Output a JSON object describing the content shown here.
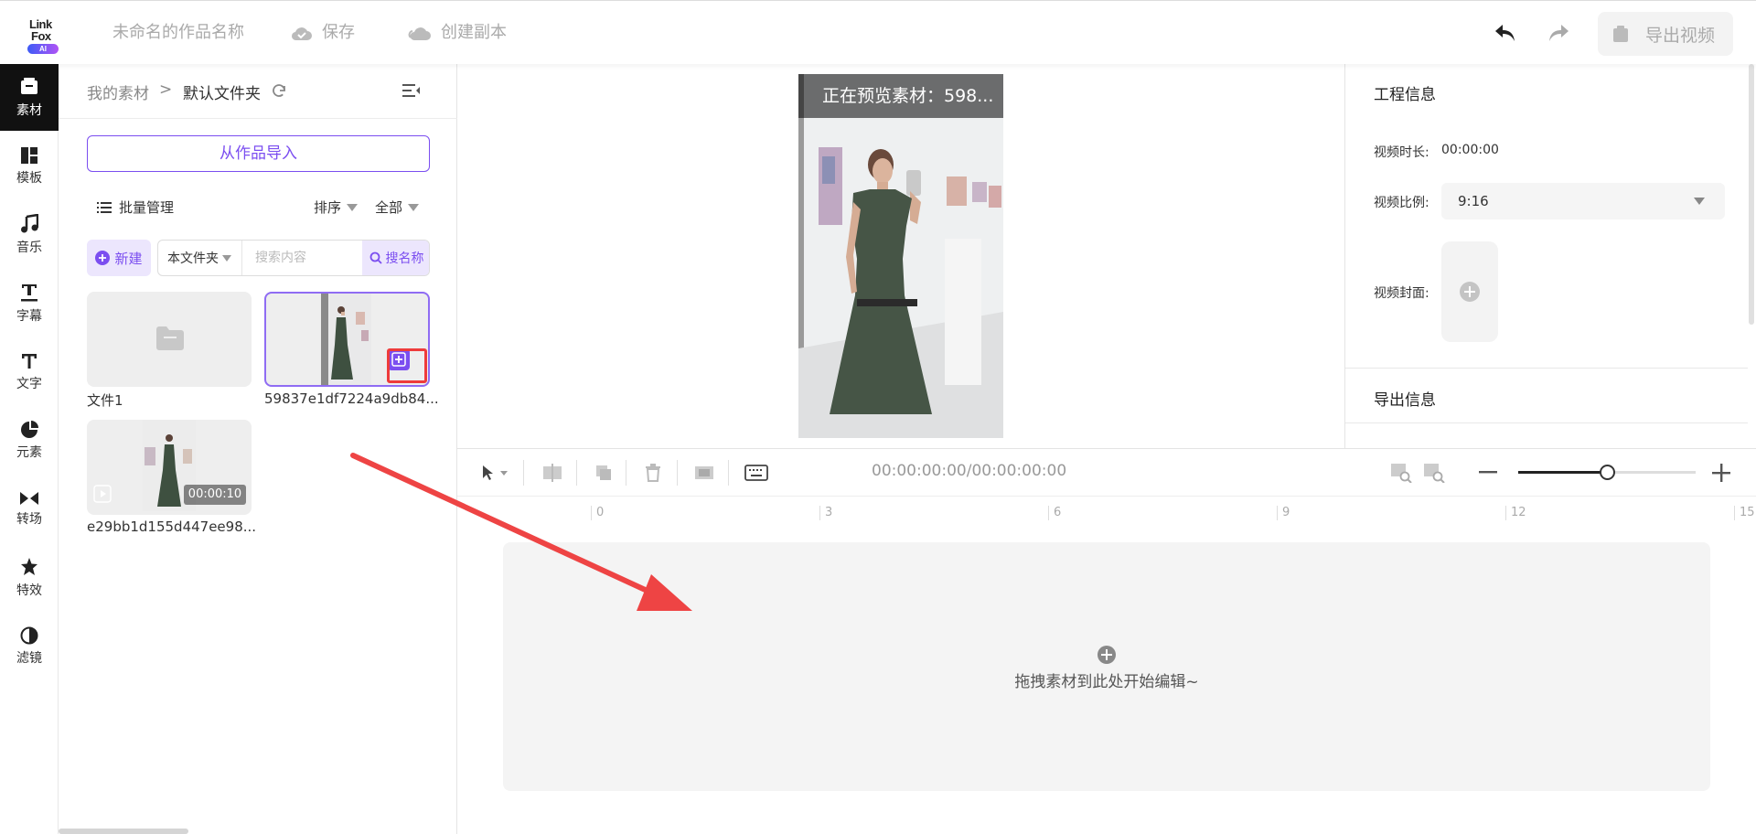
{
  "topbar": {
    "logo_line1": "Link",
    "logo_line2": "Fox",
    "logo_badge": "AI",
    "project_name": "未命名的作品名称",
    "save_label": "保存",
    "copy_label": "创建副本",
    "export_label": "导出视频"
  },
  "sidebar": {
    "items": [
      {
        "label": "素材",
        "icon": "material-icon"
      },
      {
        "label": "模板",
        "icon": "template-icon"
      },
      {
        "label": "音乐",
        "icon": "music-icon"
      },
      {
        "label": "字幕",
        "icon": "subtitle-icon"
      },
      {
        "label": "文字",
        "icon": "text-icon"
      },
      {
        "label": "元素",
        "icon": "element-icon"
      },
      {
        "label": "转场",
        "icon": "transition-icon"
      },
      {
        "label": "特效",
        "icon": "effect-icon"
      },
      {
        "label": "滤镜",
        "icon": "filter-icon"
      }
    ]
  },
  "material": {
    "breadcrumb_root": "我的素材",
    "breadcrumb_sep": ">",
    "breadcrumb_current": "默认文件夹",
    "import_label": "从作品导入",
    "batch_label": "批量管理",
    "sort_label": "排序",
    "filter_label": "全部",
    "new_label": "新建",
    "folder_select": "本文件夹",
    "search_placeholder": "搜索内容",
    "search_btn": "搜名称",
    "items": [
      {
        "name": "文件1",
        "type": "folder"
      },
      {
        "name": "59837e1df7224a9db84...",
        "type": "video"
      },
      {
        "name": "e29bb1d155d447ee98...",
        "type": "video",
        "duration": "00:00:10"
      }
    ]
  },
  "preview": {
    "banner": "正在预览素材：598..."
  },
  "info": {
    "project_title": "工程信息",
    "duration_label": "视频时长:",
    "duration_value": "00:00:00",
    "ratio_label": "视频比例:",
    "ratio_value": "9:16",
    "cover_label": "视频封面:",
    "export_title": "导出信息"
  },
  "timeline": {
    "time_display": "00:00:00:00/00:00:00:00",
    "ruler_ticks": [
      "0",
      "3",
      "6",
      "9",
      "12",
      "15"
    ],
    "drop_text": "拖拽素材到此处开始编辑~",
    "zoom_level": 0.5
  },
  "colors": {
    "accent": "#7b4ef0",
    "highlight": "#ee3b3b"
  }
}
